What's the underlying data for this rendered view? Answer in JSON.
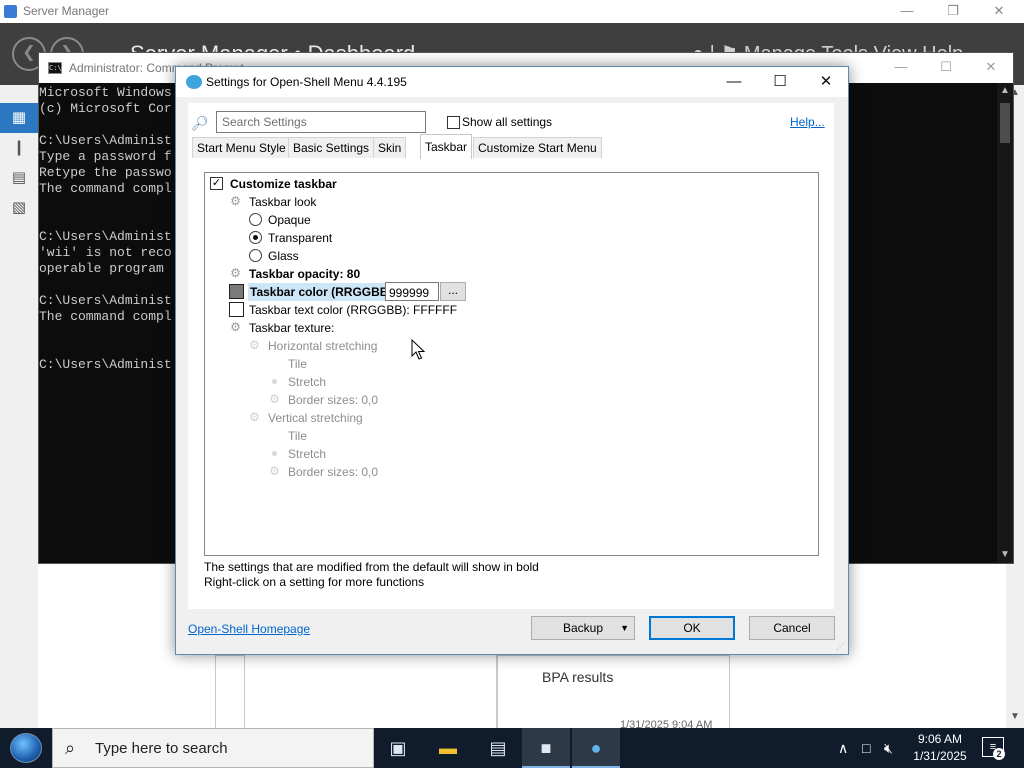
{
  "server_manager": {
    "title": "Server Manager",
    "header_title": "Server Manager • Dashboard",
    "header_right": "● | ⚑  Manage   Tools   View   Help",
    "bpa_label": "BPA results",
    "timestamp": "1/31/2025 9:04 AM"
  },
  "cmd": {
    "title": "Administrator: Command Prompt",
    "lines": [
      "Microsoft Windows",
      "(c) Microsoft Cor",
      "",
      "C:\\Users\\Administ",
      "Type a password f",
      "Retype the passwo",
      "The command compl",
      "",
      "",
      "C:\\Users\\Administ",
      "'wii' is not reco",
      "operable program",
      "",
      "C:\\Users\\Administ",
      "The command compl",
      "",
      "",
      "C:\\Users\\Administ"
    ]
  },
  "dialog": {
    "title": "Settings for Open-Shell Menu 4.4.195",
    "search_placeholder": "Search Settings",
    "show_all_label": "Show all settings",
    "show_all_checked": false,
    "help_label": "Help...",
    "tabs": [
      {
        "label": "Start Menu Style",
        "active": false
      },
      {
        "label": "Basic Settings",
        "active": false
      },
      {
        "label": "Skin",
        "active": false
      },
      {
        "label": "Taskbar",
        "active": true
      },
      {
        "label": "Customize Start Menu",
        "active": false
      }
    ],
    "tree": {
      "customize_taskbar": "Customize taskbar",
      "customize_taskbar_checked": true,
      "taskbar_look": "Taskbar look",
      "opaque": "Opaque",
      "transparent": "Transparent",
      "glass": "Glass",
      "selected_look": "Transparent",
      "taskbar_opacity": "Taskbar opacity: 80",
      "taskbar_color": "Taskbar color (RRGGBB)",
      "taskbar_color_value": "999999",
      "taskbar_color_swatch": "#7a7a7a",
      "browse_label": "...",
      "taskbar_text_color": "Taskbar text color (RRGGBB): FFFFFF",
      "taskbar_text_swatch": "#ffffff",
      "taskbar_texture": "Taskbar texture:",
      "horizontal_stretching": "Horizontal stretching",
      "h_tile": "Tile",
      "h_stretch": "Stretch",
      "h_border": "Border sizes: 0,0",
      "vertical_stretching": "Vertical stretching",
      "v_tile": "Tile",
      "v_stretch": "Stretch",
      "v_border": "Border sizes: 0,0"
    },
    "note_line1": "The settings that are modified from the default will show in bold",
    "note_line2": "Right-click on a setting for more functions",
    "homepage_label": "Open-Shell Homepage",
    "backup_label": "Backup",
    "ok_label": "OK",
    "cancel_label": "Cancel"
  },
  "taskbar": {
    "search_placeholder": "Type here to search",
    "time": "9:06 AM",
    "date": "1/31/2025",
    "notification_count": "2"
  },
  "colors": {
    "accent": "#0078d7",
    "link": "#0066cc",
    "selection": "#cde6f7",
    "taskbar_bg": "#101c2c"
  }
}
